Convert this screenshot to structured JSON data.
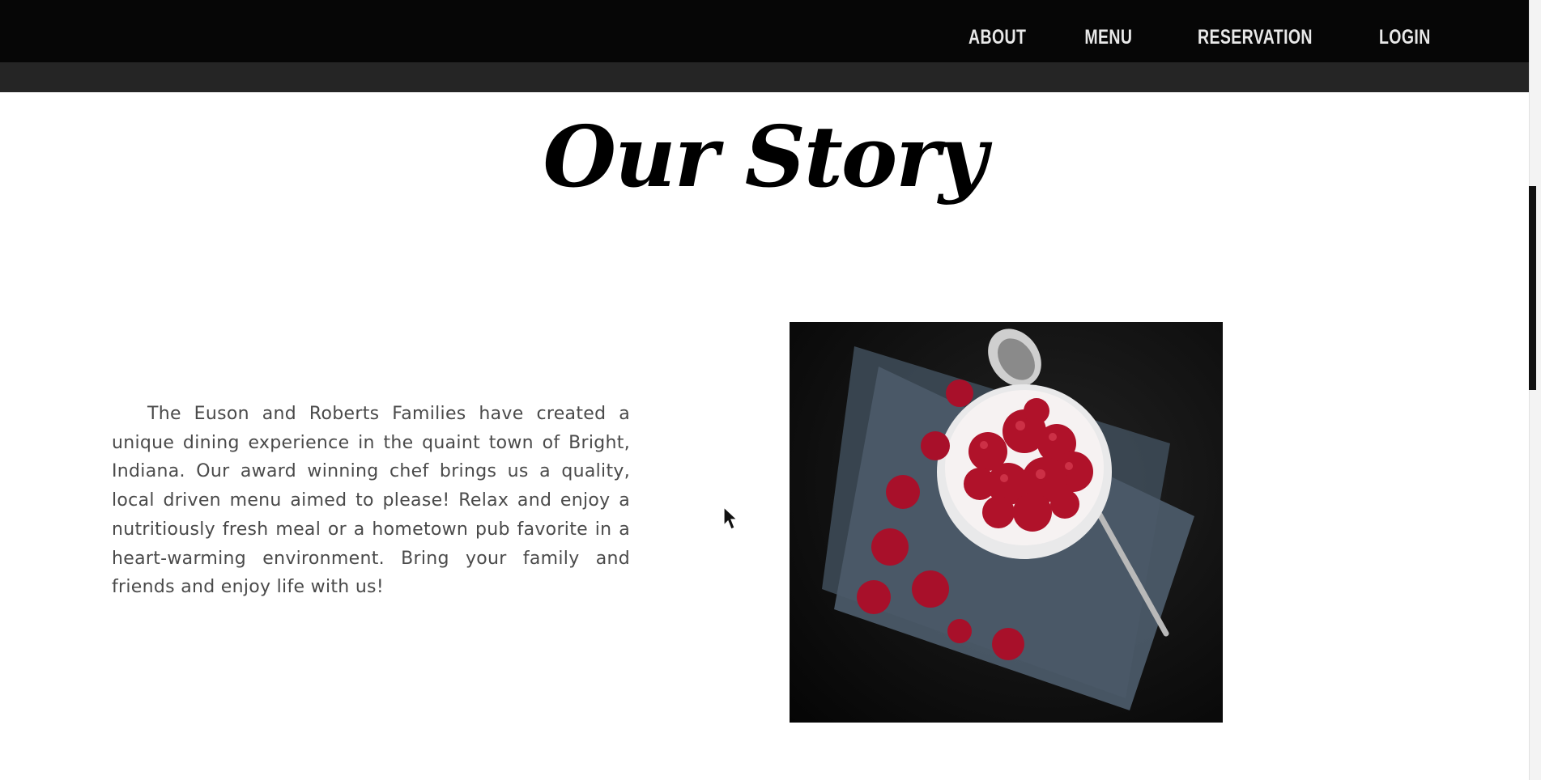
{
  "nav": {
    "items": [
      {
        "label": "ABOUT"
      },
      {
        "label": "MENU"
      },
      {
        "label": "RESERVATION"
      },
      {
        "label": "LOGIN"
      }
    ]
  },
  "main": {
    "heading": "Our Story",
    "paragraph": "The Euson and Roberts Families have created a unique dining experience in the quaint town of Bright, Indiana. Our award winning chef brings us a quality, local driven menu aimed to please! Relax and enjoy a nutritiously fresh meal or a hometown pub favorite in a heart-warming environment. Bring your family and friends and enjoy life with us!",
    "image": {
      "icon": "raspberry-dessert-photo"
    }
  },
  "colors": {
    "navbar": "#060606",
    "subbar": "#252525",
    "nav_text": "#e9e9e9",
    "body_text": "#4a4a4a",
    "raspberry": "#b0122a"
  }
}
